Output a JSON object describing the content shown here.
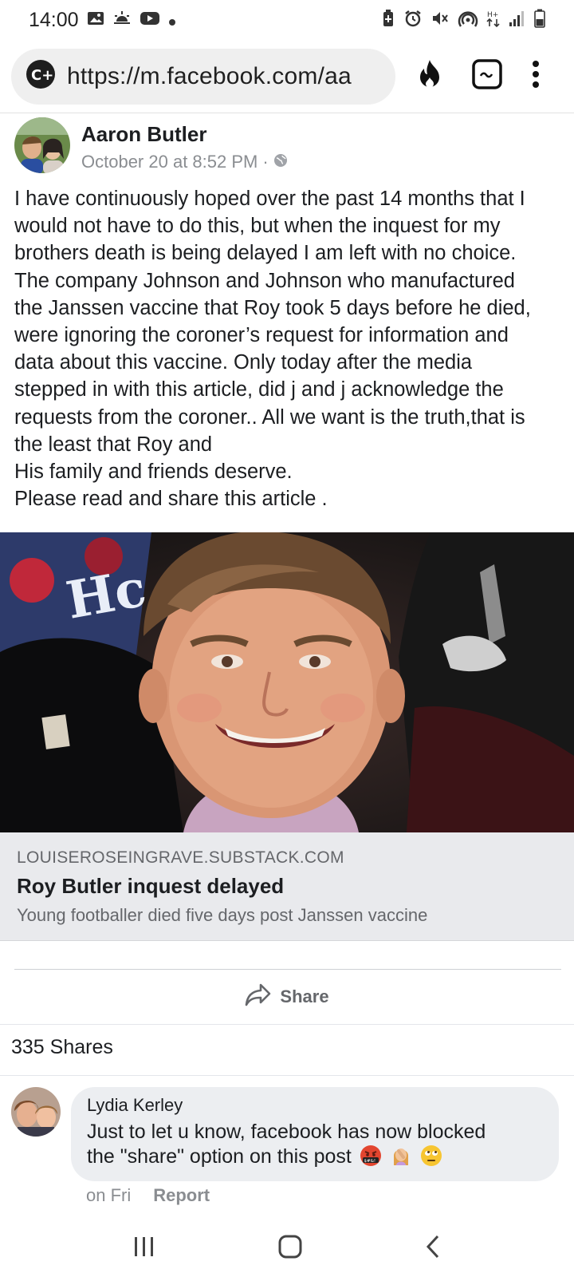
{
  "status_bar": {
    "time": "14:00"
  },
  "browser": {
    "url": "https://m.facebook.com/aa"
  },
  "post": {
    "author": "Aaron Butler",
    "timestamp": "October 20 at 8:52 PM",
    "meta_separator": "·",
    "body_lines": [
      "I have continuously hoped over the past 14 months that I",
      "would not have to do this, but when the inquest for my",
      "brothers death is being delayed I am left with no choice.",
      "The company Johnson and Johnson who manufactured",
      "the Janssen vaccine that Roy took 5 days before he died,",
      "were ignoring the coroner’s request for information and",
      "data about this vaccine. Only today after the media",
      "stepped in with this article, did j and j acknowledge the",
      "requests from the coroner.. All we want is the truth,that is",
      "the least that Roy and",
      "His family and friends deserve.",
      "Please read and share this article ."
    ],
    "link_image_text": "Hc",
    "link_domain": "LOUISEROSEINGRAVE.SUBSTACK.COM",
    "link_title": "Roy Butler inquest delayed",
    "link_description": "Young footballer died five days post Janssen vaccine",
    "share_label": "Share",
    "shares_count": "335 Shares"
  },
  "comment": {
    "name": "Lydia Kerley",
    "text_line1": "Just to let u know, facebook has now blocked",
    "text_line2": "the \"share\" option on this post",
    "emoji_1_text": "$#&!",
    "time": "on Fri",
    "report_label": "Report"
  },
  "colors": {
    "accent_text": "#1c1e21",
    "meta_gray": "#8a8d91",
    "caption_bg": "#e9eaed",
    "bubble_bg": "#eceef1"
  }
}
